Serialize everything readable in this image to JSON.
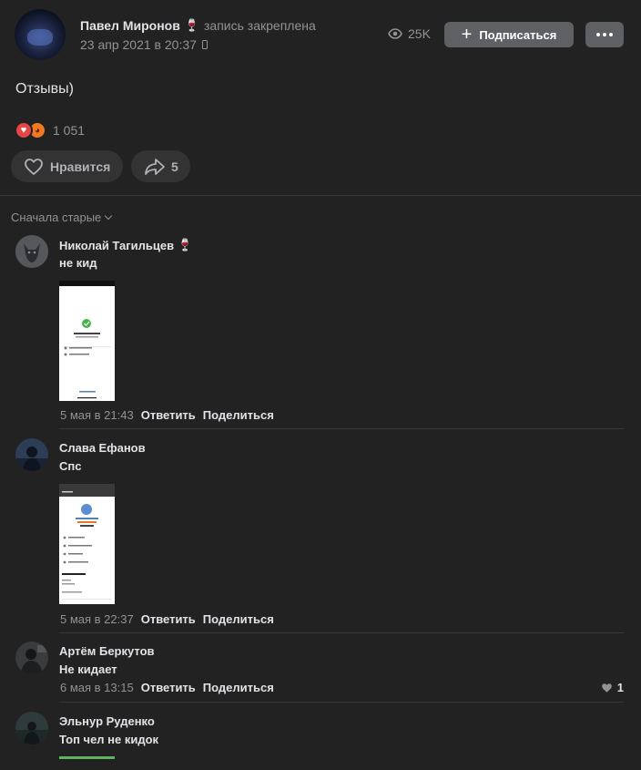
{
  "post": {
    "author": "Павел Миронов",
    "author_emoji": "🍷",
    "pinned_label": "запись закреплена",
    "date": "23 апр 2021 в 20:37",
    "views": "25K",
    "subscribe_label": "Подписаться",
    "text": "Отзывы)",
    "reactions_count": "1 051",
    "like_label": "Нравится",
    "share_count": "5"
  },
  "sort_label": "Сначала старые",
  "comments": [
    {
      "author": "Николай Тагильцев",
      "author_emoji": "🍷",
      "text": "не кид",
      "date": "5 мая в 21:43",
      "reply_label": "Ответить",
      "share_label": "Поделиться",
      "attachment": "screenshot"
    },
    {
      "author": "Слава Ефанов",
      "text": "Спс",
      "date": "5 мая в 22:37",
      "reply_label": "Ответить",
      "share_label": "Поделиться",
      "attachment": "screenshot"
    },
    {
      "author": "Артём Беркутов",
      "text": "Не кидает",
      "date": "6 мая в 13:15",
      "reply_label": "Ответить",
      "share_label": "Поделиться",
      "likes": "1"
    },
    {
      "author": "Эльнур Руденко",
      "text": "Топ чел не кидок",
      "attachment": "screenshot"
    }
  ],
  "colors": {
    "background": "#222222",
    "button": "#5e6064",
    "pill": "#333333",
    "muted": "#939393",
    "heart_reaction": "#e64646",
    "angry_reaction": "#f07a24"
  }
}
